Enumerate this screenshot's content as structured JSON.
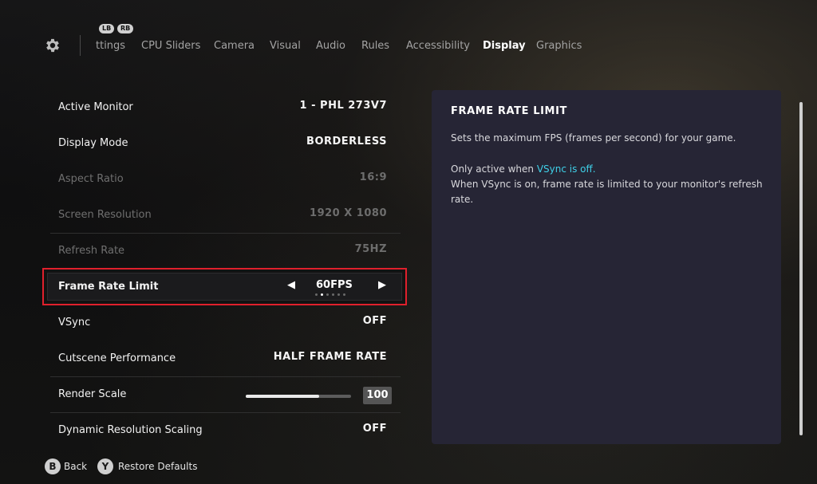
{
  "nav": {
    "bumper_left": "LB",
    "bumper_right": "RB",
    "tabs": [
      {
        "label": "ttings",
        "active": false
      },
      {
        "label": "CPU Sliders",
        "active": false
      },
      {
        "label": "Camera",
        "active": false
      },
      {
        "label": "Visual",
        "active": false
      },
      {
        "label": "Audio",
        "active": false
      },
      {
        "label": "Rules",
        "active": false
      },
      {
        "label": "Accessibility",
        "active": false
      },
      {
        "label": "Display",
        "active": true
      },
      {
        "label": "Graphics",
        "active": false
      }
    ]
  },
  "settings": {
    "active_monitor": {
      "label": "Active Monitor",
      "value": "1 - PHL 273V7"
    },
    "display_mode": {
      "label": "Display Mode",
      "value": "BORDERLESS"
    },
    "aspect_ratio": {
      "label": "Aspect Ratio",
      "value": "16:9"
    },
    "screen_resolution": {
      "label": "Screen Resolution",
      "value": "1920 X 1080"
    },
    "refresh_rate": {
      "label": "Refresh Rate",
      "value": "75HZ"
    },
    "frame_rate_limit": {
      "label": "Frame Rate Limit",
      "value": "60FPS",
      "option_index": 2,
      "option_count": 6
    },
    "vsync": {
      "label": "VSync",
      "value": "OFF"
    },
    "cutscene_performance": {
      "label": "Cutscene Performance",
      "value": "HALF FRAME RATE"
    },
    "render_scale": {
      "label": "Render Scale",
      "value": "100",
      "level": 0.7
    },
    "dynamic_resolution": {
      "label": "Dynamic Resolution Scaling",
      "value": "OFF"
    }
  },
  "panel": {
    "title": "FRAME RATE LIMIT",
    "description": "Sets the maximum FPS (frames per second) for your game.",
    "note_prefix": "Only active when",
    "note_link": "VSync is off.",
    "note_detail": "When VSync is on, frame rate is limited to your monitor's refresh rate."
  },
  "footer": {
    "back_key": "B",
    "back_label": "Back",
    "restore_key": "Y",
    "restore_label": "Restore Defaults"
  },
  "colors": {
    "highlight_border": "#e0202c",
    "link": "#3fd0e8",
    "panel_bg": "#262535"
  }
}
